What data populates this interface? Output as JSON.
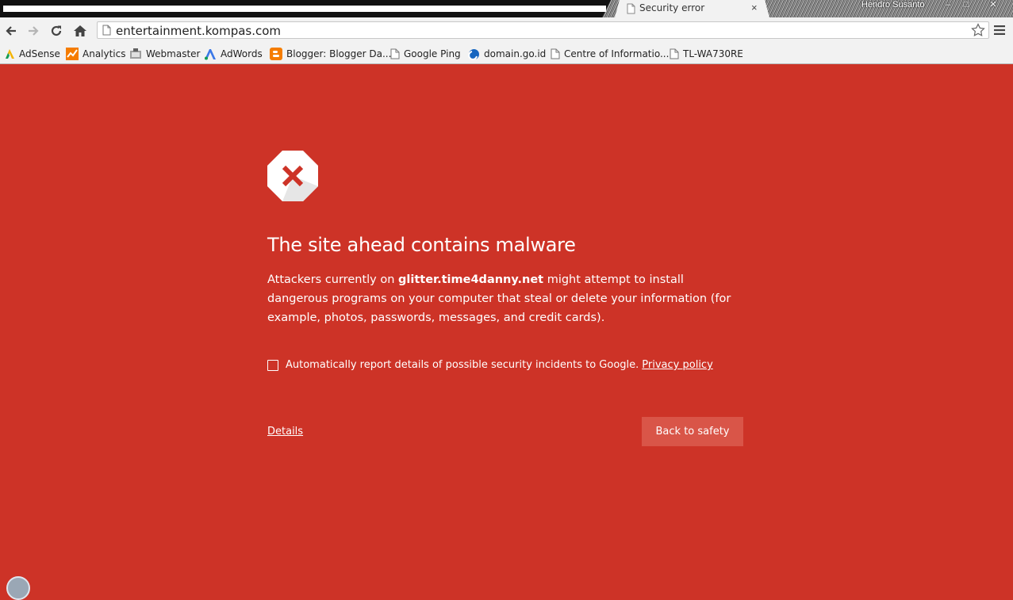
{
  "window": {
    "user": "Hendro Susanto",
    "minimize": "–",
    "maximize": "□",
    "close": "✕"
  },
  "tab": {
    "title": "Security error",
    "close": "×"
  },
  "toolbar": {
    "url": "entertainment.kompas.com"
  },
  "bookmarks": [
    {
      "label": "AdSense",
      "icon": "adsense-icon"
    },
    {
      "label": "Analytics",
      "icon": "analytics-icon"
    },
    {
      "label": "Webmaster",
      "icon": "webmaster-icon"
    },
    {
      "label": "AdWords",
      "icon": "adwords-icon"
    },
    {
      "label": "Blogger: Blogger Da...",
      "icon": "blogger-icon"
    },
    {
      "label": "Google Ping",
      "icon": "page-icon"
    },
    {
      "label": "domain.go.id",
      "icon": "domain-icon"
    },
    {
      "label": "Centre of Informatio...",
      "icon": "page-icon"
    },
    {
      "label": "TL-WA730RE",
      "icon": "page-icon"
    }
  ],
  "interstitial": {
    "heading": "The site ahead contains malware",
    "body_prefix": "Attackers currently on ",
    "site": "glitter.time4danny.net",
    "body_suffix": " might attempt to install dangerous programs on your computer that steal or delete your information (for example, photos, passwords, messages, and credit cards).",
    "report_label": "Automatically report details of possible security incidents to Google.",
    "privacy_link": "Privacy policy",
    "details_link": "Details",
    "back_button": "Back to safety"
  },
  "colors": {
    "background": "#cd3327",
    "button": "#d95548"
  }
}
